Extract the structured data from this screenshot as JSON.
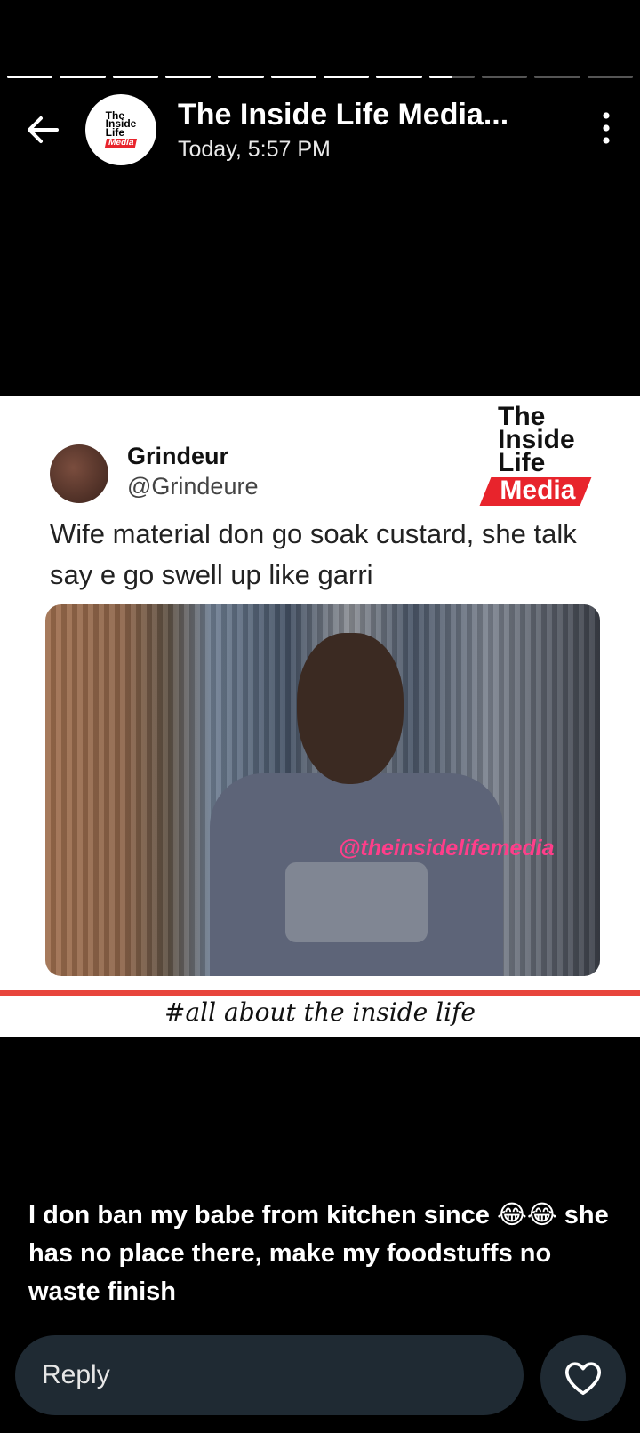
{
  "story": {
    "segments_total": 12,
    "segments_completed": 8,
    "current_segment_progress": 0.5
  },
  "header": {
    "account_name": "The Inside Life Media...",
    "timestamp": "Today, 5:57 PM",
    "avatar_logo_lines": [
      "The",
      "Inside",
      "Life",
      "Media"
    ]
  },
  "post": {
    "brand_lines": [
      "The",
      "Inside",
      "Life",
      "Media"
    ],
    "tweet_name": "Grindeur",
    "tweet_handle": "@Grindeure",
    "tweet_text": "Wife material don go soak custard, she talk say e go swell up like garri",
    "watermark": "@theinsidelifemedia",
    "hashtag": "#all about the inside life"
  },
  "caption": "I don ban my babe from kitchen since 😂😂 she has no place there, make my foodstuffs no waste finish",
  "reply": {
    "placeholder": "Reply"
  },
  "icons": {
    "back": "back-arrow-icon",
    "more": "more-vertical-icon",
    "heart": "heart-icon"
  },
  "colors": {
    "accent_red": "#e8242c",
    "reply_bg": "#1f2a33"
  }
}
